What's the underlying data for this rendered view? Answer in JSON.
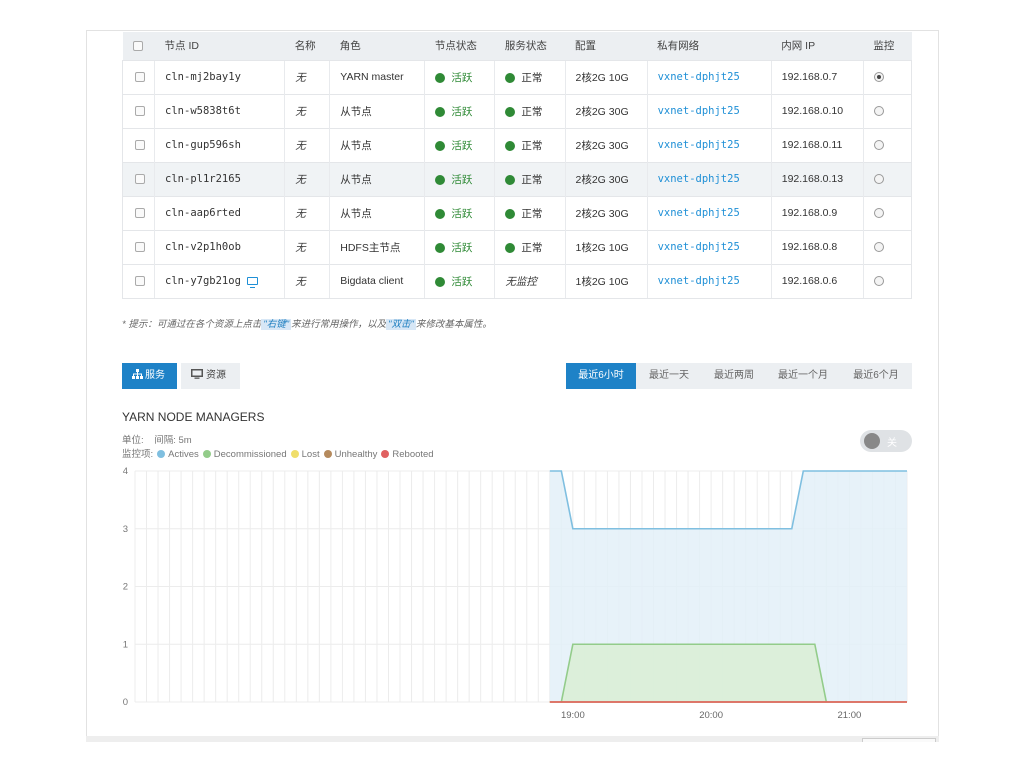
{
  "table": {
    "headers": [
      "",
      "节点 ID",
      "名称",
      "角色",
      "节点状态",
      "服务状态",
      "配置",
      "私有网络",
      "内网 IP",
      "监控"
    ],
    "rows": [
      {
        "id": "cln-mj2bay1y",
        "name": "无",
        "role": "YARN master",
        "node_status": "活跃",
        "service_status": "正常",
        "config": "2核2G 10G",
        "vxnet": "vxnet-dphjt25",
        "ip": "192.168.0.7",
        "monitor_selected": true
      },
      {
        "id": "cln-w5838t6t",
        "name": "无",
        "role": "从节点",
        "node_status": "活跃",
        "service_status": "正常",
        "config": "2核2G 30G",
        "vxnet": "vxnet-dphjt25",
        "ip": "192.168.0.10",
        "monitor_selected": false
      },
      {
        "id": "cln-gup596sh",
        "name": "无",
        "role": "从节点",
        "node_status": "活跃",
        "service_status": "正常",
        "config": "2核2G 30G",
        "vxnet": "vxnet-dphjt25",
        "ip": "192.168.0.11",
        "monitor_selected": false
      },
      {
        "id": "cln-pl1r2165",
        "name": "无",
        "role": "从节点",
        "node_status": "活跃",
        "service_status": "正常",
        "config": "2核2G 30G",
        "vxnet": "vxnet-dphjt25",
        "ip": "192.168.0.13",
        "monitor_selected": false
      },
      {
        "id": "cln-aap6rted",
        "name": "无",
        "role": "从节点",
        "node_status": "活跃",
        "service_status": "正常",
        "config": "2核2G 30G",
        "vxnet": "vxnet-dphjt25",
        "ip": "192.168.0.9",
        "monitor_selected": false
      },
      {
        "id": "cln-v2p1h0ob",
        "name": "无",
        "role": "HDFS主节点",
        "node_status": "活跃",
        "service_status": "正常",
        "config": "1核2G 10G",
        "vxnet": "vxnet-dphjt25",
        "ip": "192.168.0.8",
        "monitor_selected": false
      },
      {
        "id": "cln-y7gb21og",
        "name": "无",
        "role": "Bigdata client",
        "node_status": "活跃",
        "service_status": "无监控",
        "config": "1核2G 10G",
        "vxnet": "vxnet-dphjt25",
        "ip": "192.168.0.6",
        "monitor_selected": false
      }
    ],
    "highlighted_row": 3
  },
  "hint": {
    "prefix": "* 提示：可通过在各个资源上点击",
    "kw1": "\"右键\"",
    "middle": "来进行常用操作，以及",
    "kw2": "\"双击\"",
    "suffix": "来修改基本属性。"
  },
  "tabs": {
    "services": "服务",
    "resources": "资源"
  },
  "time_ranges": [
    "最近6小时",
    "最近一天",
    "最近两周",
    "最近一个月",
    "最近6个月"
  ],
  "time_range_active": 0,
  "chart_header": {
    "title": "YARN NODE MANAGERS",
    "unit_label": "单位:",
    "interval": "间隔: 5m",
    "monitor_label": "监控项:"
  },
  "toggle": {
    "label": "关",
    "on": false
  },
  "colors": {
    "accent": "#1e82c7",
    "active_green": "#2f8a36",
    "link_blue": "#1e8fd6"
  },
  "chart_data": {
    "type": "area",
    "title": "YARN NODE MANAGERS",
    "x_unit": "time (HH:MM, 5m interval)",
    "x_range": [
      "15:50",
      "21:25"
    ],
    "x_ticks": [
      "19:00",
      "20:00",
      "21:00"
    ],
    "y_ticks": [
      0,
      1,
      2,
      3,
      4
    ],
    "ylim": [
      0,
      4
    ],
    "grid": true,
    "series": [
      {
        "name": "Actives",
        "color": "#7fbfe0",
        "fill": "#e3f0f8",
        "points": [
          [
            "18:50",
            4
          ],
          [
            "18:55",
            4
          ],
          [
            "19:00",
            3
          ],
          [
            "20:35",
            3
          ],
          [
            "20:40",
            4
          ],
          [
            "21:25",
            4
          ]
        ]
      },
      {
        "name": "Decommissioned",
        "color": "#93cc8a",
        "fill": "#d9eed5",
        "points": [
          [
            "18:55",
            0
          ],
          [
            "19:00",
            1
          ],
          [
            "20:45",
            1
          ],
          [
            "20:50",
            0
          ]
        ]
      },
      {
        "name": "Lost",
        "color": "#f0de6a",
        "points": [
          [
            "18:50",
            0
          ],
          [
            "21:25",
            0
          ]
        ]
      },
      {
        "name": "Unhealthy",
        "color": "#b58a5d",
        "points": [
          [
            "18:50",
            0
          ],
          [
            "21:25",
            0
          ]
        ]
      },
      {
        "name": "Rebooted",
        "color": "#e06060",
        "points": [
          [
            "18:50",
            0
          ],
          [
            "21:25",
            0
          ]
        ]
      }
    ]
  }
}
